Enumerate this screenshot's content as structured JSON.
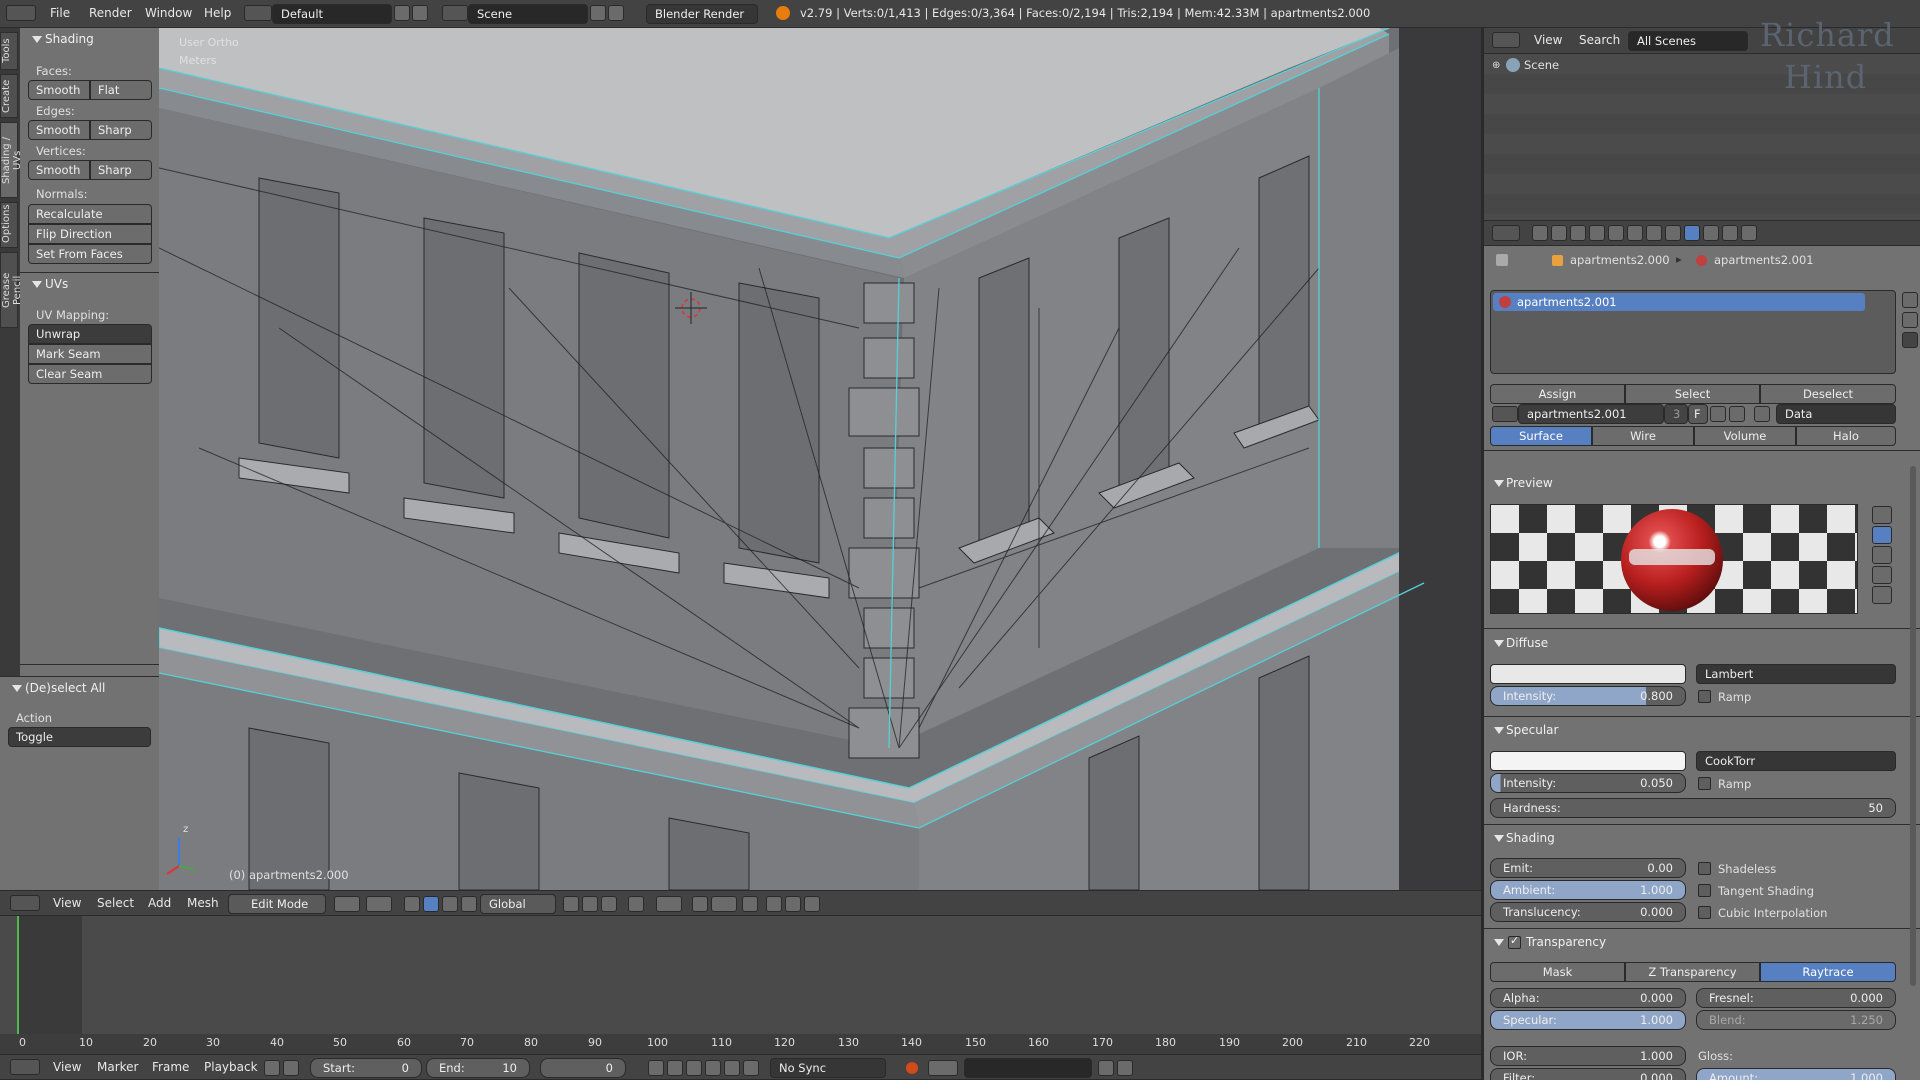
{
  "topbar": {
    "menus": [
      "File",
      "Render",
      "Window",
      "Help"
    ],
    "layout": "Default",
    "scene": "Scene",
    "engine": "Blender Render",
    "stats": "v2.79 | Verts:0/1,413 | Edges:0/3,364 | Faces:0/2,194 | Tris:2,194 | Mem:42.33M | apartments2.000"
  },
  "left_tabs": [
    "Tools",
    "Create",
    "Shading / UVs",
    "Options",
    "Grease Pencil"
  ],
  "toolshelf": {
    "shading_header": "Shading",
    "faces_label": "Faces:",
    "edges_label": "Edges:",
    "vertices_label": "Vertices:",
    "smooth": "Smooth",
    "flat": "Flat",
    "sharp": "Sharp",
    "normals_label": "Normals:",
    "recalculate": "Recalculate",
    "flip_direction": "Flip Direction",
    "set_from_faces": "Set From Faces",
    "uvs_header": "UVs",
    "uv_mapping_label": "UV Mapping:",
    "unwrap": "Unwrap",
    "mark_seam": "Mark Seam",
    "clear_seam": "Clear Seam"
  },
  "operator": {
    "header": "(De)select All",
    "action_label": "Action",
    "action_value": "Toggle"
  },
  "viewport": {
    "view_name": "User Ortho",
    "units": "Meters",
    "object_label": "(0) apartments2.000",
    "axis_z": "z"
  },
  "view3d_header": {
    "menus": [
      "View",
      "Select",
      "Add",
      "Mesh"
    ],
    "mode": "Edit Mode",
    "orientation": "Global"
  },
  "timeline": {
    "ticks": [
      "0",
      "10",
      "20",
      "30",
      "40",
      "50",
      "60",
      "70",
      "80",
      "90",
      "100",
      "110",
      "120",
      "130",
      "140",
      "150",
      "160",
      "170",
      "180",
      "190",
      "200",
      "210",
      "220"
    ],
    "menus": [
      "View",
      "Marker",
      "Frame",
      "Playback"
    ],
    "start_label": "Start:",
    "start_value": "0",
    "end_label": "End:",
    "end_value": "10",
    "current_frame": "0",
    "sync": "No Sync"
  },
  "outliner": {
    "menus": [
      "View",
      "Search"
    ],
    "filter": "All Scenes",
    "scene_item": "Scene",
    "watermark_line1": "Richard",
    "watermark_line2": "Hind"
  },
  "properties": {
    "breadcrumb_object": "apartments2.000",
    "breadcrumb_material": "apartments2.001",
    "slot_name": "apartments2.001",
    "assign": "Assign",
    "select": "Select",
    "deselect": "Deselect",
    "material_name": "apartments2.001",
    "material_users": "3",
    "fake_user": "F",
    "link": "Data",
    "type_tabs": [
      "Surface",
      "Wire",
      "Volume",
      "Halo"
    ],
    "preview_header": "Preview",
    "diffuse_header": "Diffuse",
    "diffuse_shader": "Lambert",
    "diffuse_intensity_label": "Intensity:",
    "diffuse_intensity": "0.800",
    "ramp": "Ramp",
    "specular_header": "Specular",
    "specular_shader": "CookTorr",
    "specular_intensity_label": "Intensity:",
    "specular_intensity": "0.050",
    "hardness_label": "Hardness:",
    "hardness": "50",
    "shading_header": "Shading",
    "emit_label": "Emit:",
    "emit": "0.00",
    "ambient_label": "Ambient:",
    "ambient": "1.000",
    "translucency_label": "Translucency:",
    "translucency": "0.000",
    "shadeless": "Shadeless",
    "tangent_shading": "Tangent Shading",
    "cubic_interpolation": "Cubic Interpolation",
    "transparency_header": "Transparency",
    "transparency_tabs": [
      "Mask",
      "Z Transparency",
      "Raytrace"
    ],
    "alpha_label": "Alpha:",
    "alpha": "0.000",
    "fresnel_label": "Fresnel:",
    "fresnel": "0.000",
    "spec_label": "Specular:",
    "spec": "1.000",
    "blend_label": "Blend:",
    "blend": "1.250",
    "ior_label": "IOR:",
    "ior": "1.000",
    "gloss_label": "Gloss:",
    "filter_label": "Filter:",
    "filter": "0.000",
    "amount_label": "Amount:",
    "amount": "1.000"
  },
  "colors": {
    "accent": "#5680c2",
    "panel": "#727272",
    "viewport": "#3d3d3d",
    "wire": "#55d0d8"
  }
}
